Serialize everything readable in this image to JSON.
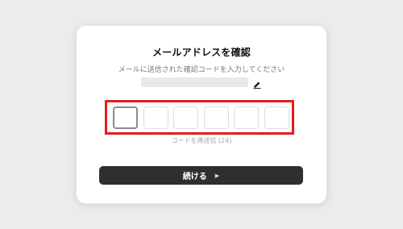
{
  "card": {
    "title": "メールアドレスを確認",
    "subtitle": "メールに送信された確認コードを入力してください",
    "email_value": "",
    "resend_label": "コードを再送信 (24)",
    "continue_label": "続ける",
    "continue_arrow": "▶"
  },
  "code_inputs": [
    "",
    "",
    "",
    "",
    "",
    ""
  ],
  "icons": {
    "edit": "pencil-icon",
    "arrow": "play-arrow-icon"
  },
  "colors": {
    "background": "#ececec",
    "card": "#ffffff",
    "button": "#2f2f33",
    "highlight": "#e31d1d"
  }
}
